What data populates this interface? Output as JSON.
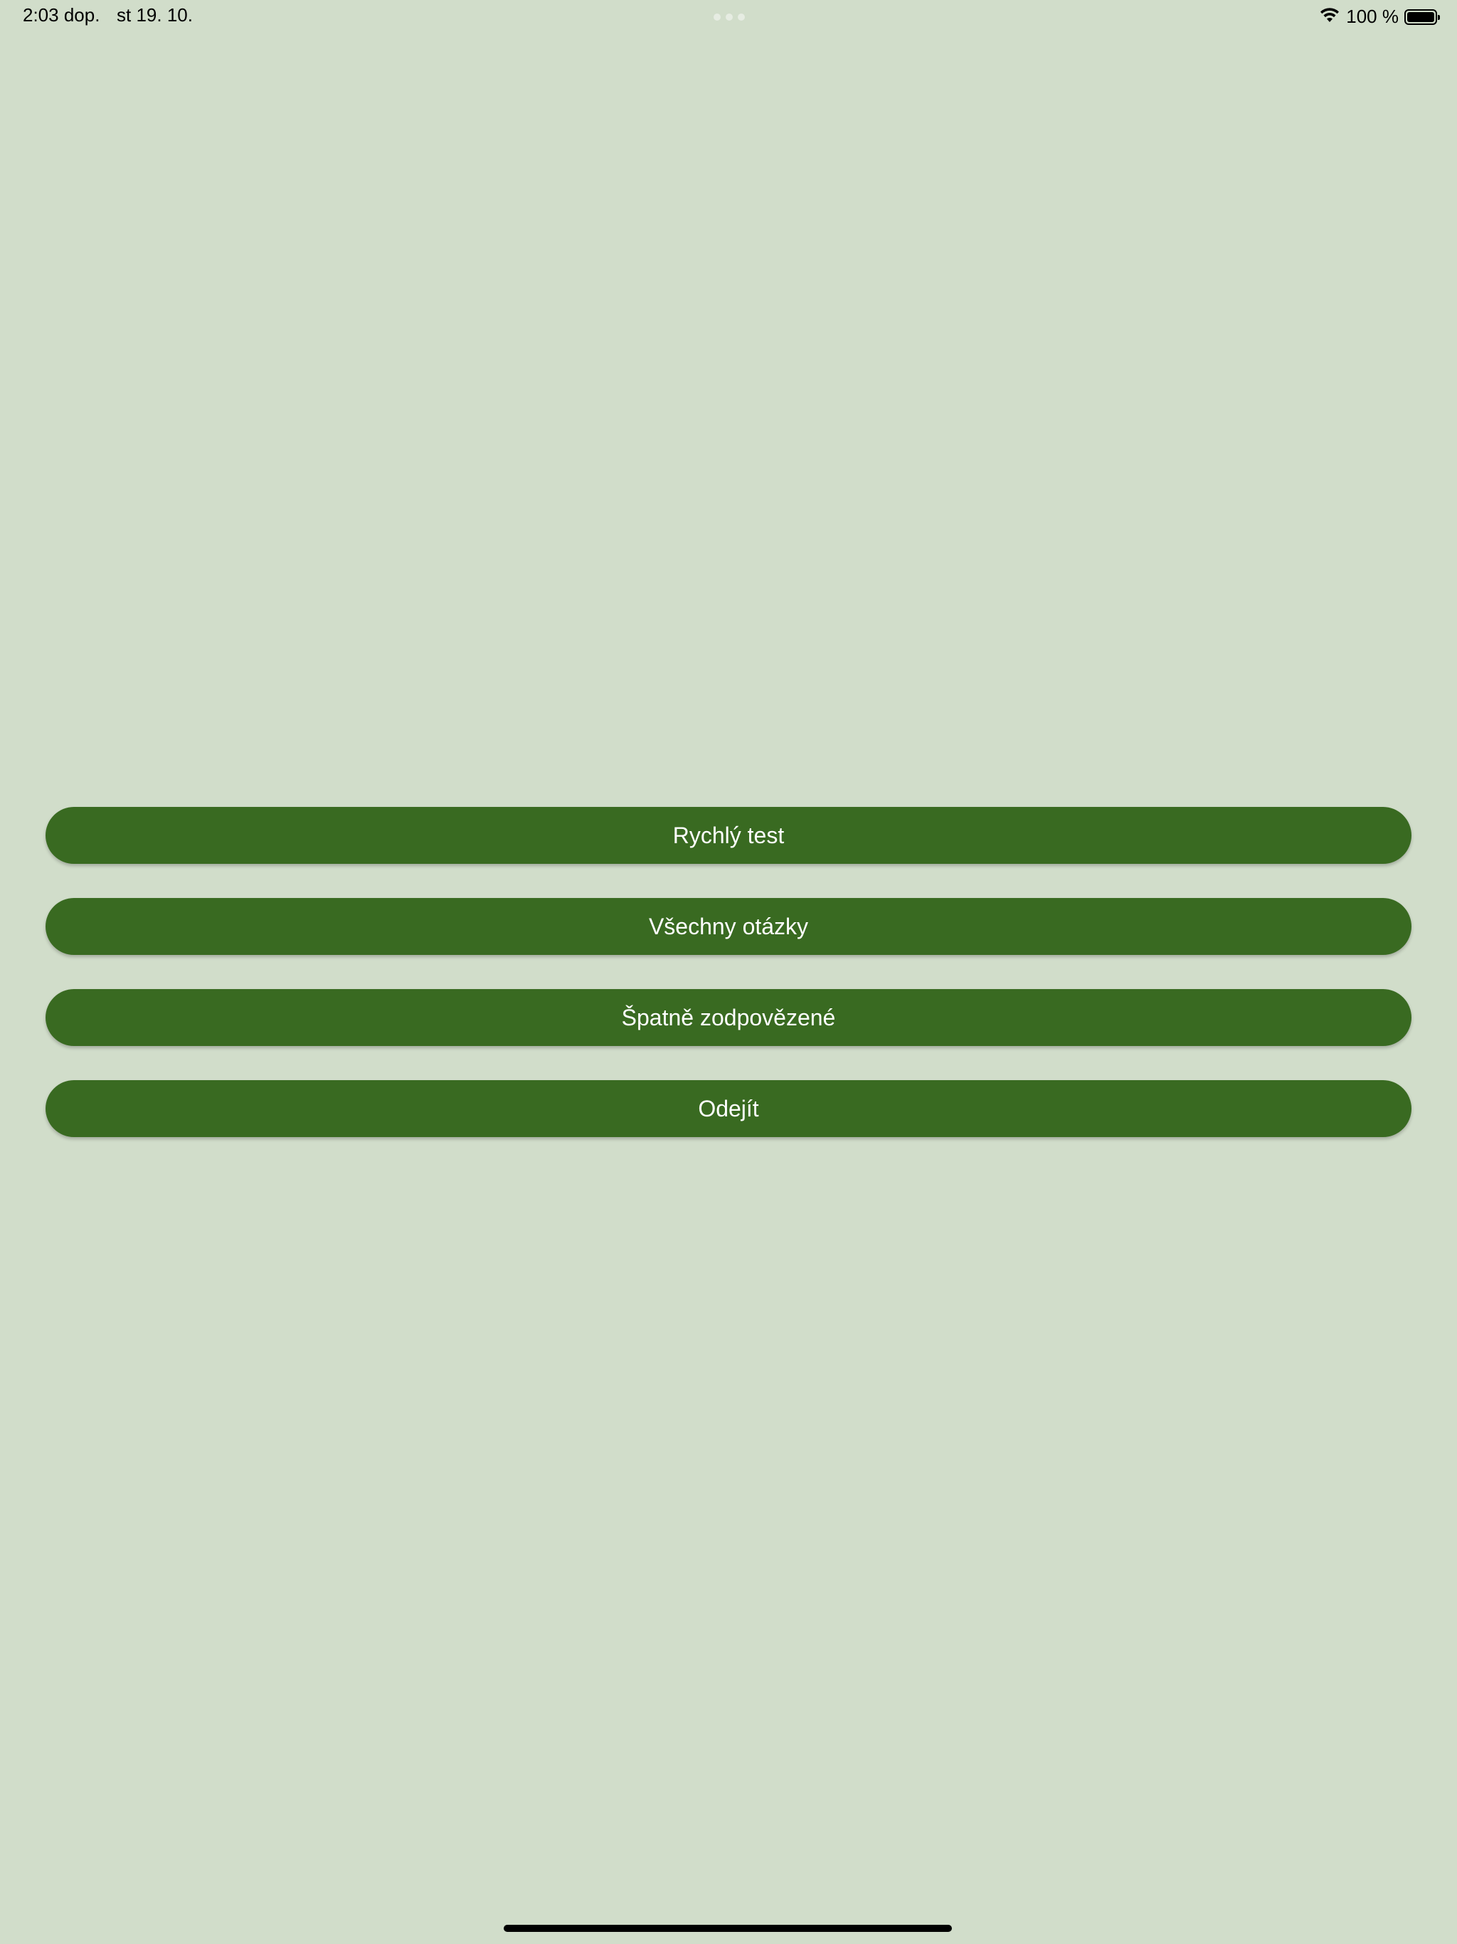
{
  "status_bar": {
    "time": "2:03 dop.",
    "date": "st 19. 10.",
    "battery_percent": "100 %",
    "battery_level": 1.0,
    "wifi_icon": "wifi-icon",
    "battery_icon": "battery-icon"
  },
  "menu": {
    "buttons": [
      {
        "label": "Rychlý test"
      },
      {
        "label": "Všechny otázky"
      },
      {
        "label": "Špatně zodpovězené"
      },
      {
        "label": "Odejít"
      }
    ]
  },
  "colors": {
    "background": "#d1ddca",
    "button": "#396a21",
    "button_text": "#ffffff"
  }
}
